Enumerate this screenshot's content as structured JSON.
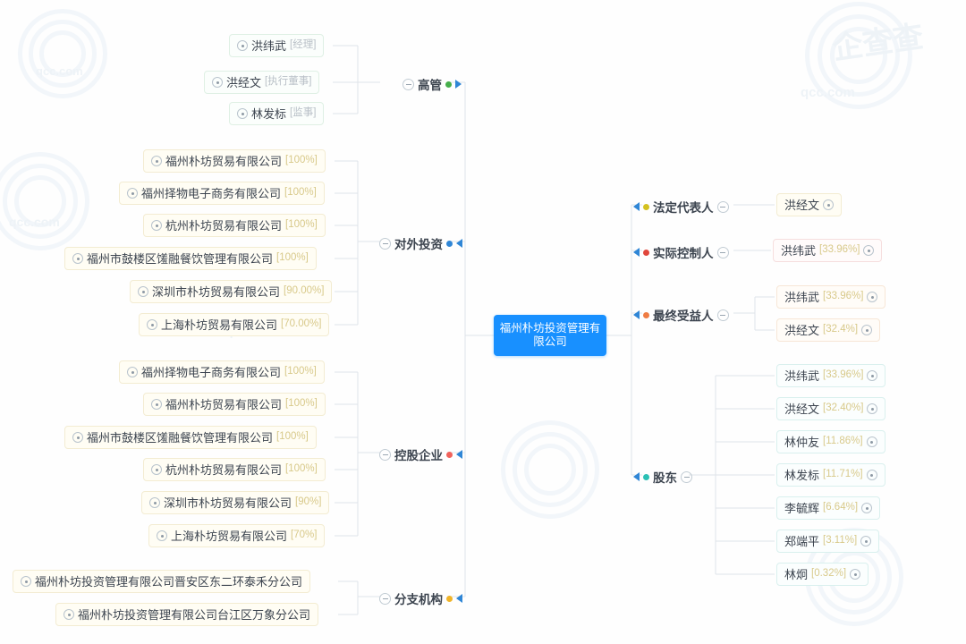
{
  "center": {
    "name": "福州朴坊投资管理有限公司",
    "color": "#1890ff"
  },
  "watermarks": [
    {
      "text": "qcc.com"
    },
    {
      "text": "企查查"
    }
  ],
  "branches": {
    "executives": {
      "label": "高管",
      "dot_color": "#46ae4b",
      "arrow": "right",
      "toggle": "minus"
    },
    "outbound_investment": {
      "label": "对外投资",
      "dot_color": "#2f86d6",
      "arrow": "left",
      "toggle": "minus"
    },
    "holding_enterprise": {
      "label": "控股企业",
      "dot_color": "#f0625b",
      "arrow": "left",
      "toggle": "minus"
    },
    "branch_offices": {
      "label": "分支机构",
      "dot_color": "#f0b429",
      "arrow": "left",
      "toggle": "minus"
    },
    "legal_representative": {
      "label": "法定代表人",
      "dot_color": "#d4c11f",
      "arrow": "left",
      "toggle": "minus"
    },
    "actual_controller": {
      "label": "实际控制人",
      "dot_color": "#e0463c",
      "arrow": "left",
      "toggle": "minus"
    },
    "final_beneficiary": {
      "label": "最终受益人",
      "dot_color": "#ef7c43",
      "arrow": "left",
      "toggle": "minus"
    },
    "shareholders": {
      "label": "股东",
      "dot_color": "#2ac0b4",
      "arrow": "left",
      "toggle": "minus"
    }
  },
  "executives": [
    {
      "name": "洪纬武",
      "role": "[经理]"
    },
    {
      "name": "洪经文",
      "role": "[执行董事]"
    },
    {
      "name": "林发标",
      "role": "[监事]"
    }
  ],
  "outbound_investment": [
    {
      "name": "福州朴坊贸易有限公司",
      "pct": "[100%]"
    },
    {
      "name": "福州择物电子商务有限公司",
      "pct": "[100%]"
    },
    {
      "name": "杭州朴坊贸易有限公司",
      "pct": "[100%]"
    },
    {
      "name": "福州市鼓楼区馐融餐饮管理有限公司",
      "pct": "[100%]"
    },
    {
      "name": "深圳市朴坊贸易有限公司",
      "pct": "[90.00%]"
    },
    {
      "name": "上海朴坊贸易有限公司",
      "pct": "[70.00%]"
    }
  ],
  "holding_enterprise": [
    {
      "name": "福州择物电子商务有限公司",
      "pct": "[100%]"
    },
    {
      "name": "福州朴坊贸易有限公司",
      "pct": "[100%]"
    },
    {
      "name": "福州市鼓楼区馐融餐饮管理有限公司",
      "pct": "[100%]"
    },
    {
      "name": "杭州朴坊贸易有限公司",
      "pct": "[100%]"
    },
    {
      "name": "深圳市朴坊贸易有限公司",
      "pct": "[90%]"
    },
    {
      "name": "上海朴坊贸易有限公司",
      "pct": "[70%]"
    }
  ],
  "branch_offices": [
    {
      "name": "福州朴坊投资管理有限公司晋安区东二环泰禾分公司",
      "pct": ""
    },
    {
      "name": "福州朴坊投资管理有限公司台江区万象分公司",
      "pct": ""
    }
  ],
  "legal_representative": [
    {
      "name": "洪经文",
      "pct": ""
    }
  ],
  "actual_controller": [
    {
      "name": "洪纬武",
      "pct": "[33.96%]"
    }
  ],
  "final_beneficiary": [
    {
      "name": "洪纬武",
      "pct": "[33.96%]"
    },
    {
      "name": "洪经文",
      "pct": "[32.4%]"
    }
  ],
  "shareholders": [
    {
      "name": "洪纬武",
      "pct": "[33.96%]"
    },
    {
      "name": "洪经文",
      "pct": "[32.40%]"
    },
    {
      "name": "林仲友",
      "pct": "[11.86%]"
    },
    {
      "name": "林发标",
      "pct": "[11.71%]"
    },
    {
      "name": "李毓辉",
      "pct": "[6.64%]"
    },
    {
      "name": "郑端平",
      "pct": "[3.11%]"
    },
    {
      "name": "林炯",
      "pct": "[0.32%]"
    }
  ]
}
